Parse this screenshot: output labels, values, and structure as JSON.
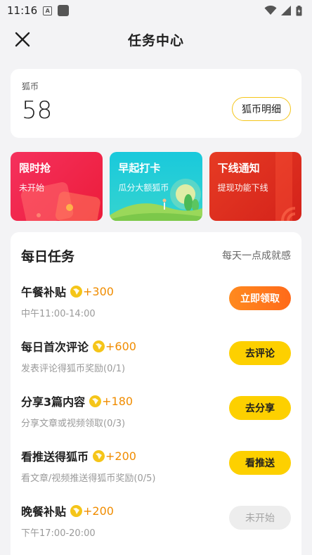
{
  "status": {
    "time": "11:16"
  },
  "nav": {
    "title": "任务中心"
  },
  "coins": {
    "label": "狐币",
    "value": "58",
    "detail_button": "狐币明细"
  },
  "banners": [
    {
      "title": "限时抢",
      "subtitle": "未开始"
    },
    {
      "title": "早起打卡",
      "subtitle": "瓜分大额狐币"
    },
    {
      "title": "下线通知",
      "subtitle": "提现功能下线"
    }
  ],
  "daily": {
    "title": "每日任务",
    "subtitle": "每天一点成就感",
    "tasks": [
      {
        "name": "午餐补贴",
        "reward": "+300",
        "desc": "中午11:00-14:00",
        "button": "立即领取"
      },
      {
        "name": "每日首次评论",
        "reward": "+600",
        "desc": "发表评论得狐币奖励(0/1)",
        "button": "去评论"
      },
      {
        "name": "分享3篇内容",
        "reward": "+180",
        "desc": "分享文章或视频领取(0/3)",
        "button": "去分享"
      },
      {
        "name": "看推送得狐币",
        "reward": "+200",
        "desc": "看文章/视频推送得狐币奖励(0/5)",
        "button": "看推送"
      },
      {
        "name": "晚餐补贴",
        "reward": "+200",
        "desc": "下午17:00-20:00",
        "button": "未开始"
      }
    ]
  }
}
